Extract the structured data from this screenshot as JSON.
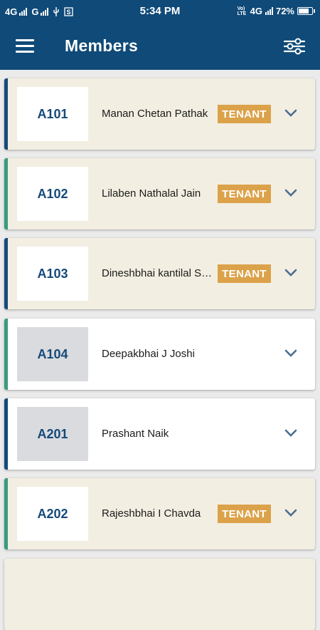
{
  "status_bar": {
    "network_left": "4G",
    "network_second": "G",
    "time": "5:34 PM",
    "volte": "Vo) LTE",
    "network_right": "4G",
    "battery": "72%",
    "battery_level": 0.72
  },
  "header": {
    "title": "Members",
    "menu_icon": "hamburger-menu-icon",
    "filter_icon": "sliders-filter-icon"
  },
  "colors": {
    "primary": "#0f4a78",
    "accent_navy": "#15497a",
    "accent_green": "#3a9a7f",
    "tenant_badge": "#dca24a",
    "card_beige": "#f2eee1"
  },
  "members": [
    {
      "unit": "A101",
      "name": "Manan Chetan Pathak",
      "badge": "TENANT",
      "accent": "navy",
      "style": "beige"
    },
    {
      "unit": "A102",
      "name": "Lilaben Nathalal Jain",
      "badge": "TENANT",
      "accent": "green",
      "style": "beige"
    },
    {
      "unit": "A103",
      "name": "Dineshbhai kantilal Shah",
      "badge": "TENANT",
      "accent": "navy",
      "style": "beige"
    },
    {
      "unit": "A104",
      "name": "Deepakbhai J Joshi",
      "badge": "",
      "accent": "green",
      "style": "white"
    },
    {
      "unit": "A201",
      "name": "Prashant Naik",
      "badge": "",
      "accent": "navy",
      "style": "white"
    },
    {
      "unit": "A202",
      "name": "Rajeshbhai I Chavda",
      "badge": "TENANT",
      "accent": "green",
      "style": "beige"
    }
  ]
}
